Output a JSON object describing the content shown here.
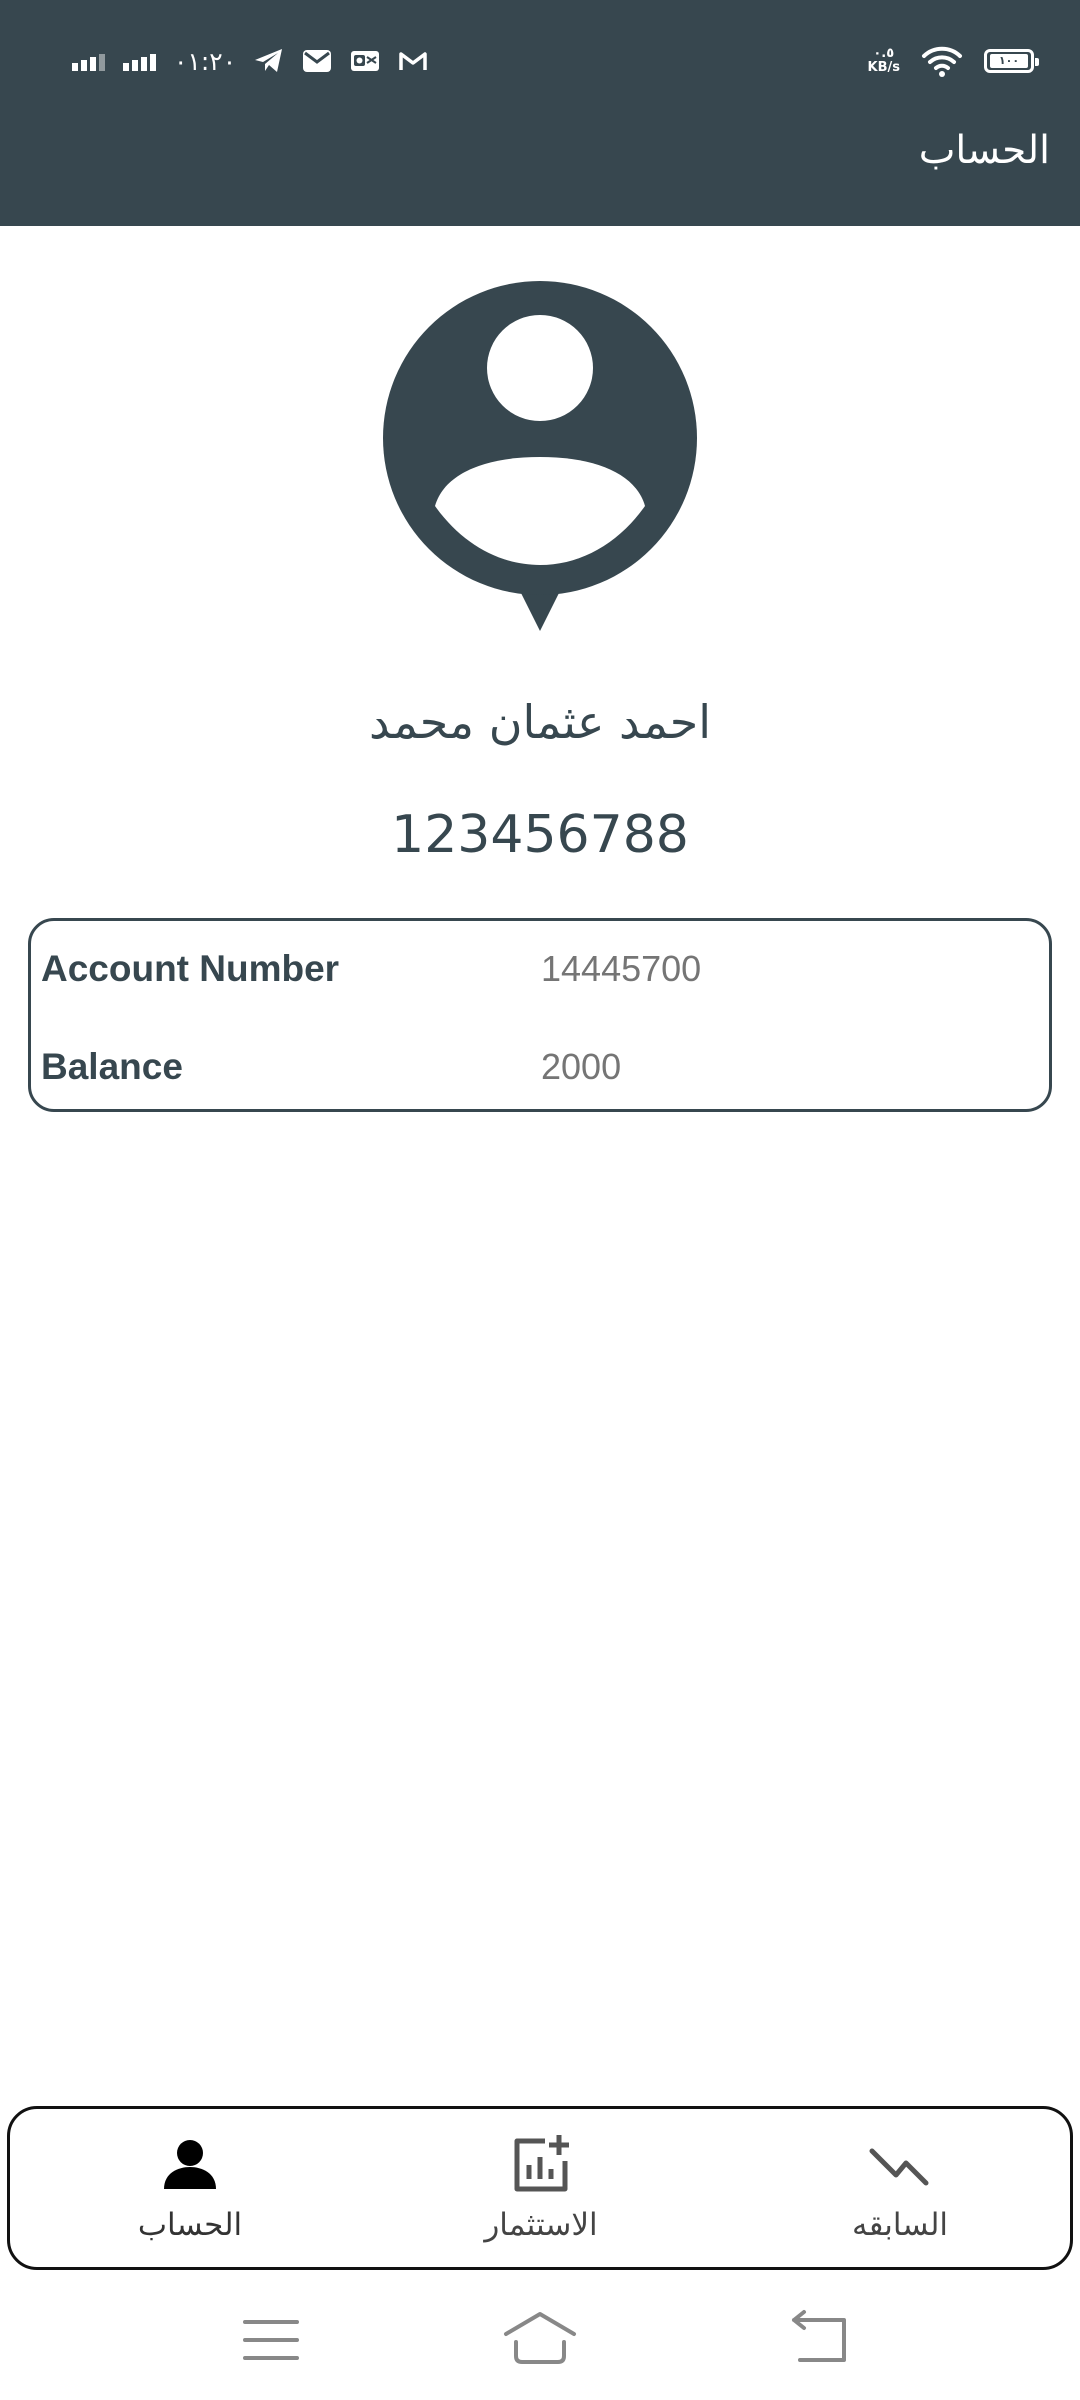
{
  "status_bar": {
    "time": "٠١:٢٠",
    "net_speed_value": "٠.٥",
    "net_speed_unit": "KB/s",
    "battery": "١٠٠"
  },
  "header": {
    "title": "الحساب"
  },
  "profile": {
    "name": "احمد عثمان محمد",
    "phone": "123456788"
  },
  "account": {
    "rows": [
      {
        "label": "Account Number",
        "value": "14445700"
      },
      {
        "label": "Balance",
        "value": "2000"
      }
    ]
  },
  "bottom_nav": {
    "items": [
      {
        "label": "الحساب",
        "icon": "person-icon",
        "active": true
      },
      {
        "label": "الاستثمار",
        "icon": "add-chart-icon",
        "active": false
      },
      {
        "label": "السابقه",
        "icon": "trending-down-icon",
        "active": false
      }
    ]
  },
  "colors": {
    "primary": "#37474f",
    "value_text": "#757575"
  }
}
